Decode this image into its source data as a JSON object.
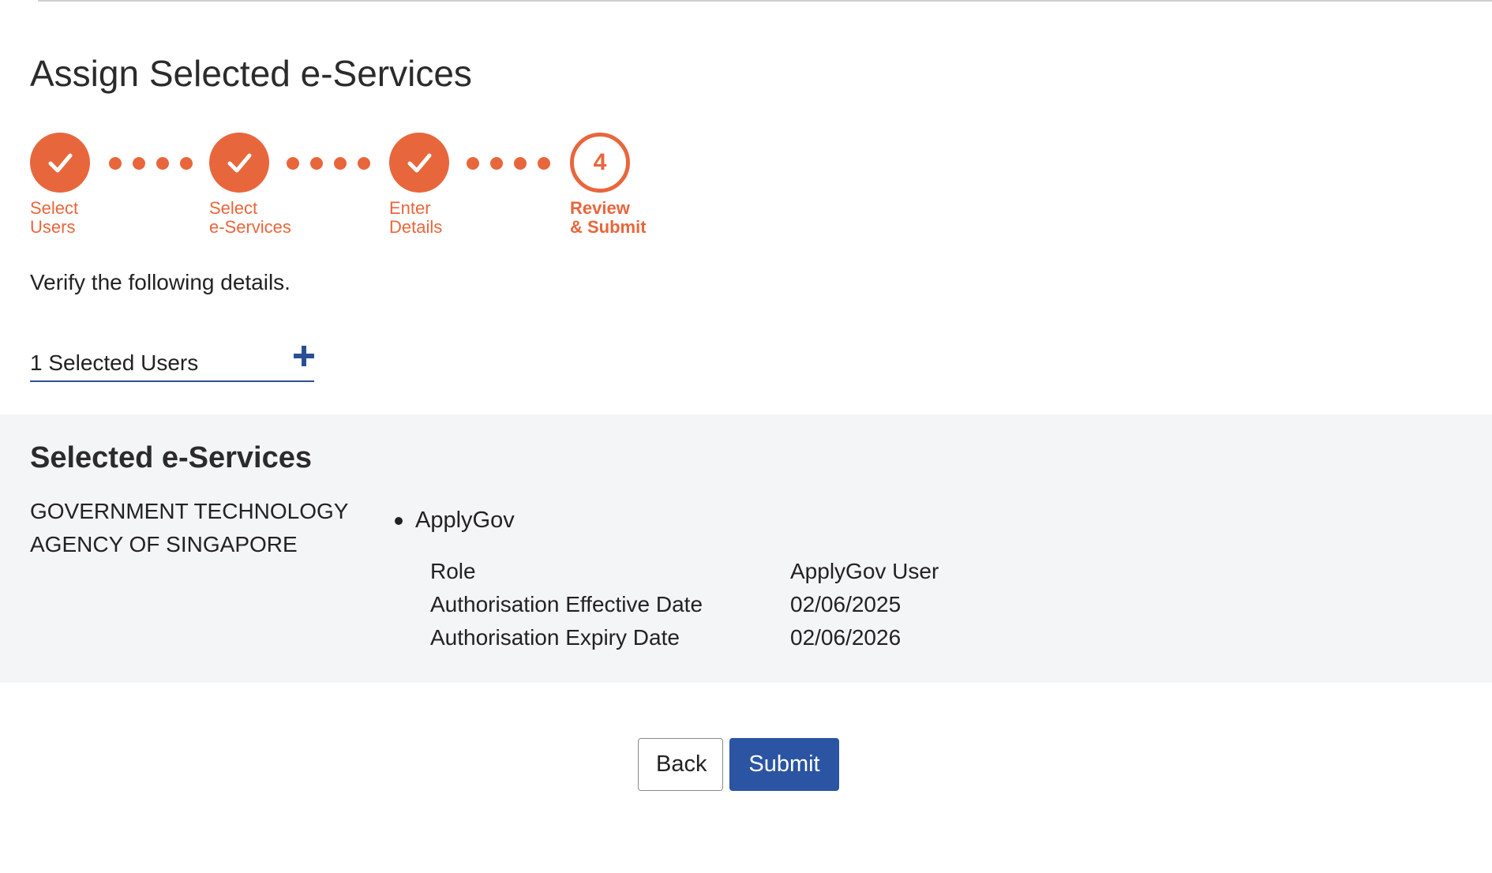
{
  "page": {
    "title": "Assign Selected e-Services",
    "instruction": "Verify the following details."
  },
  "stepper": {
    "accent_color": "#e8663c",
    "steps": [
      {
        "label": "Select\nUsers",
        "state": "done",
        "icon": "check-icon"
      },
      {
        "label": "Select\ne-Services",
        "state": "done",
        "icon": "check-icon"
      },
      {
        "label": "Enter\nDetails",
        "state": "done",
        "icon": "check-icon"
      },
      {
        "label": "Review\n& Submit",
        "state": "current",
        "number": "4"
      }
    ]
  },
  "selected_users": {
    "text": "1 Selected Users",
    "icon": "plus-icon"
  },
  "services": {
    "title": "Selected e-Services",
    "agency": "GOVERNMENT TECHNOLOGY AGENCY OF SINGAPORE",
    "items": [
      {
        "name": "ApplyGov",
        "details": [
          {
            "label": "Role",
            "value": "ApplyGov User"
          },
          {
            "label": "Authorisation Effective Date",
            "value": "02/06/2025"
          },
          {
            "label": "Authorisation Expiry Date",
            "value": "02/06/2026"
          }
        ]
      }
    ]
  },
  "actions": {
    "back_label": "Back",
    "submit_label": "Submit",
    "submit_color": "#2b55a3"
  }
}
